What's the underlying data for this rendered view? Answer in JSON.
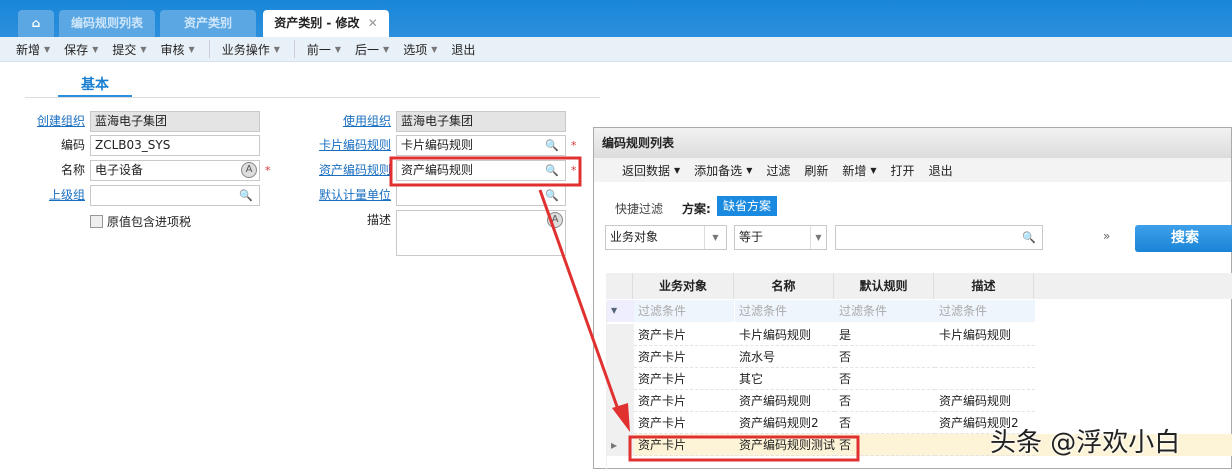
{
  "tabs": [
    {
      "label": "编码规则列表"
    },
    {
      "label": "资产类别"
    },
    {
      "label": "资产类别 - 修改"
    }
  ],
  "toolbar": [
    "新增",
    "保存",
    "提交",
    "审核",
    "业务操作",
    "前一",
    "后一",
    "选项",
    "退出"
  ],
  "section_tab": "基本",
  "form": {
    "create_org": {
      "label": "创建组织",
      "value": "蓝海电子集团"
    },
    "code": {
      "label": "编码",
      "value": "ZCLB03_SYS"
    },
    "name": {
      "label": "名称",
      "value": "电子设备"
    },
    "parent": {
      "label": "上级组",
      "value": ""
    },
    "tax_checkbox": {
      "label": "原值包含进项税",
      "checked": false
    },
    "use_org": {
      "label": "使用组织",
      "value": "蓝海电子集团"
    },
    "card_rule": {
      "label": "卡片编码规则",
      "value": "卡片编码规则"
    },
    "asset_rule": {
      "label": "资产编码规则",
      "value": "资产编码规则"
    },
    "unit": {
      "label": "默认计量单位",
      "value": ""
    },
    "desc": {
      "label": "描述",
      "value": ""
    }
  },
  "dialog": {
    "title": "编码规则列表",
    "toolbar": [
      "返回数据",
      "添加备选",
      "过滤",
      "刷新",
      "新增",
      "打开",
      "退出"
    ],
    "quick_filter": "快捷过滤",
    "scheme_label": "方案:",
    "scheme": "缺省方案",
    "field_select": "业务对象",
    "op_select": "等于",
    "search_value": "",
    "search_button": "搜索",
    "columns": [
      "业务对象",
      "名称",
      "默认规则",
      "描述"
    ],
    "filter_placeholder": "过滤条件",
    "rows": [
      [
        "资产卡片",
        "卡片编码规则",
        "是",
        "卡片编码规则"
      ],
      [
        "资产卡片",
        "流水号",
        "否",
        ""
      ],
      [
        "资产卡片",
        "其它",
        "否",
        ""
      ],
      [
        "资产卡片",
        "资产编码规则",
        "否",
        "资产编码规则"
      ],
      [
        "资产卡片",
        "资产编码规则2",
        "否",
        "资产编码规则2"
      ],
      [
        "资产卡片",
        "资产编码规则测试",
        "否",
        ""
      ]
    ]
  },
  "watermark": "头条 @浮欢小白"
}
